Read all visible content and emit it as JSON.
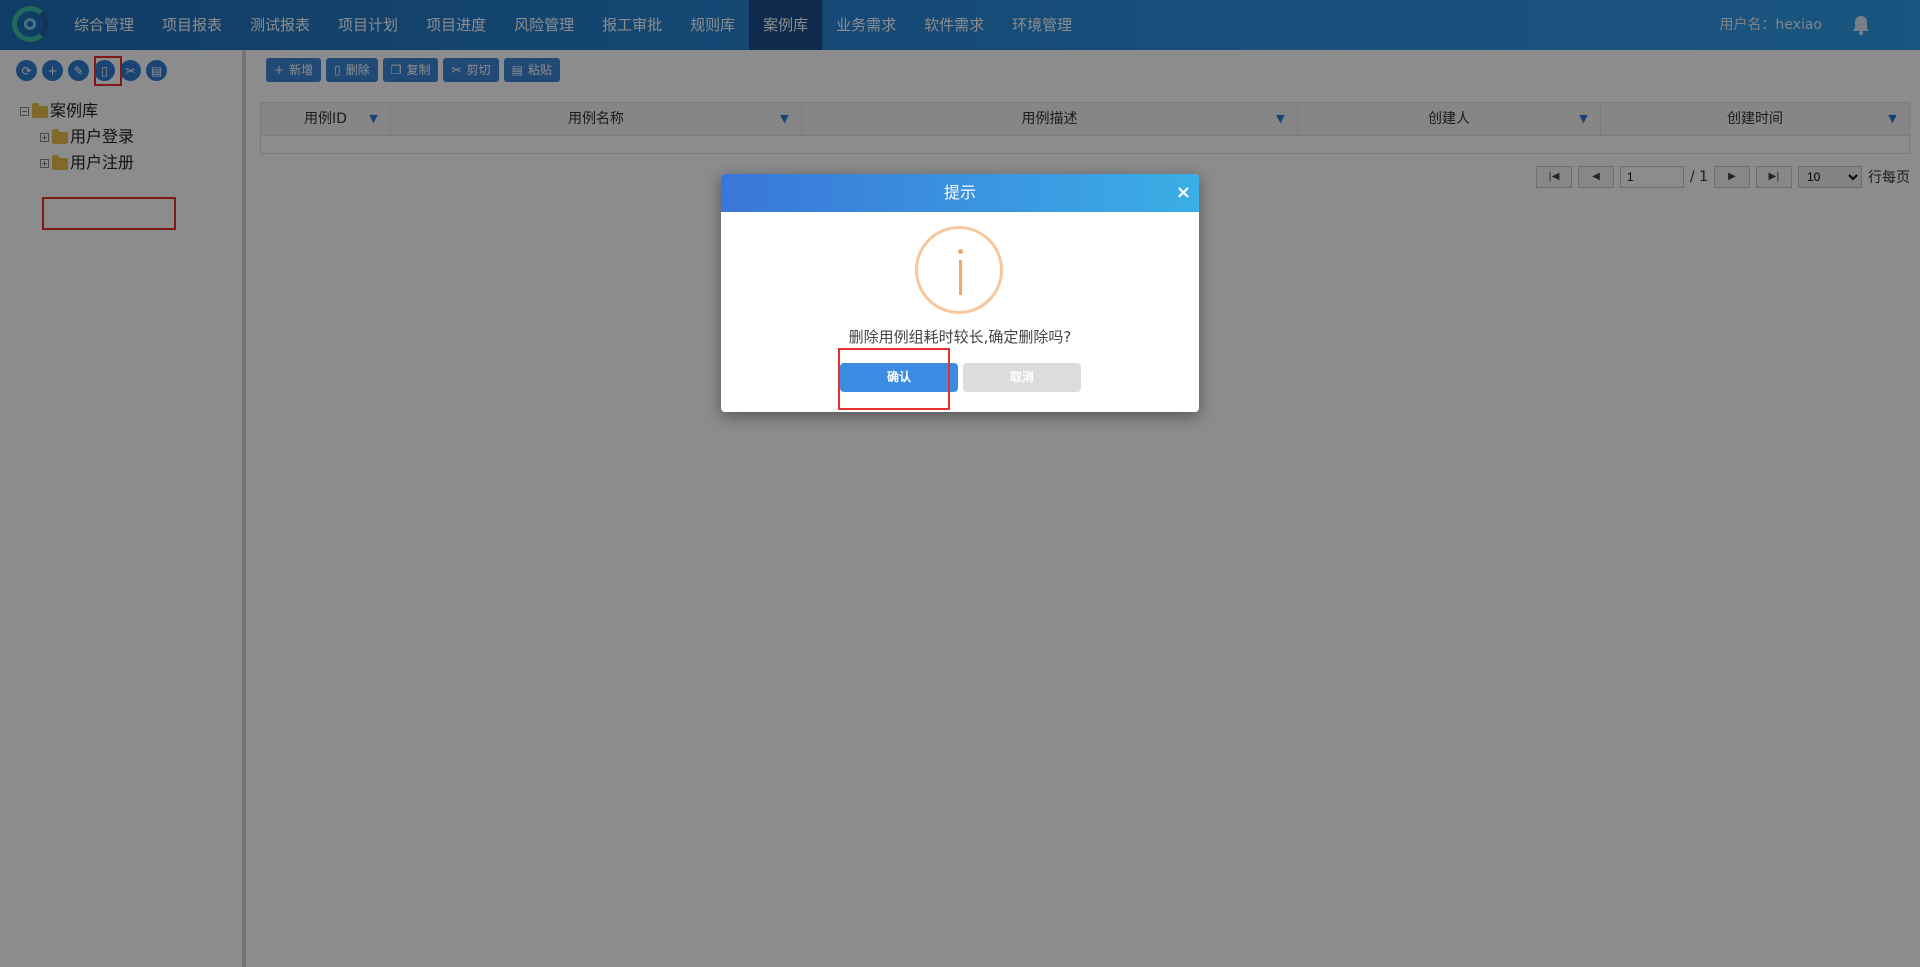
{
  "nav": {
    "items": [
      "综合管理",
      "项目报表",
      "测试报表",
      "项目计划",
      "项目进度",
      "风险管理",
      "报工审批",
      "规则库",
      "案例库",
      "业务需求",
      "软件需求",
      "环境管理"
    ],
    "active_index": 8,
    "user_label": "用户名：hexiao"
  },
  "tree": {
    "tools": [
      "refresh-icon",
      "plus-icon",
      "edit-icon",
      "trash-icon",
      "cut-icon",
      "paste-icon"
    ],
    "root": "案例库",
    "children": [
      "用户登录",
      "用户注册"
    ]
  },
  "toolbar": {
    "add": "新增",
    "delete": "删除",
    "copy": "复制",
    "cut": "剪切",
    "paste": "粘贴"
  },
  "grid": {
    "columns": [
      "用例ID",
      "用例名称",
      "用例描述",
      "创建人",
      "创建时间"
    ]
  },
  "pager": {
    "page": "1",
    "total": "/ 1",
    "page_size": "10",
    "per_page_label": "行每页"
  },
  "dialog": {
    "title": "提示",
    "close": "×",
    "message": "删除用例组耗时较长,确定删除吗?",
    "ok": "确认",
    "cancel": "取消"
  },
  "colors": {
    "nav": "#2b8ee0",
    "highlight": "#e8312f",
    "primary": "#3a8de3"
  }
}
